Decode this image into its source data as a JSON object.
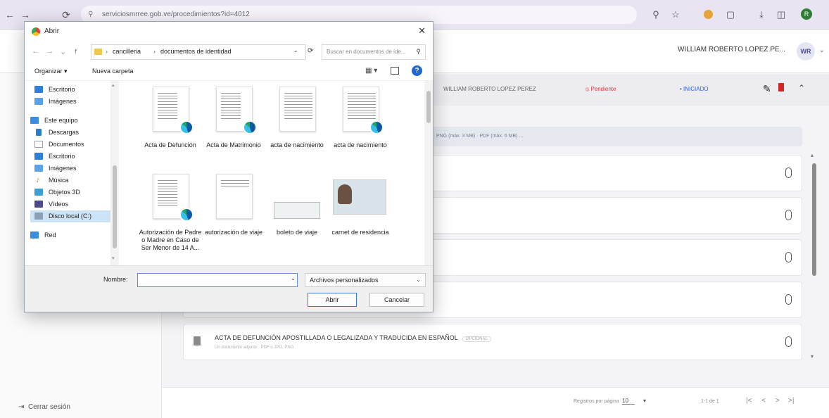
{
  "browser": {
    "url_text": "serviciosmrree.gob.ve/procedimientos?id=4012",
    "nav": [
      "←",
      "→",
      "⟳"
    ],
    "icons": [
      "zoom-icon",
      "star-icon",
      "extension-icon",
      "puzzle-icon",
      "download-icon",
      "sidepanel-icon",
      "profile-icon"
    ],
    "profile_letter": "R",
    "accent": "#2e7d32"
  },
  "app": {
    "user_name": "WILLIAM ROBERTO LOPEZ PE...",
    "avatar_initials": "WR",
    "logout_label": "Cerrar sesión",
    "header": {
      "name": "WILLIAM ROBERTO LOPEZ PEREZ",
      "status_pending": "⦸ Pendiente",
      "status_started": "• INICIADO"
    },
    "info_text": "PNG (máx. 3 MB) · PDF (máx. 6 MB) ...",
    "documents": [
      {
        "title": "",
        "subtitle": ""
      },
      {
        "title": "",
        "subtitle": ""
      },
      {
        "title": "",
        "subtitle": ""
      },
      {
        "title": "",
        "subtitle": ""
      },
      {
        "title": "ACTA DE DEFUNCIÓN APOSTILLADA O LEGALIZADA Y TRADUCIDA EN ESPAÑOL",
        "tag": "OPCIONAL",
        "subtitle": "Un documento adjunto · PDF o JPG, PNG"
      }
    ],
    "pagination": {
      "rows_label": "Registros por página",
      "rows_value": "10",
      "range": "1-1 de 1",
      "controls": [
        "|<",
        "<",
        ">",
        ">|"
      ]
    }
  },
  "dialog": {
    "title": "Abrir",
    "close": "✕",
    "nav_arrows": [
      "←",
      "→",
      "⌄",
      "↑"
    ],
    "breadcrumb": [
      "cancilleria",
      "documentos de identidad"
    ],
    "breadcrumb_sep": "›",
    "search_placeholder": "Buscar en documentos de ide...",
    "organize_label": "Organizar ▾",
    "new_folder_label": "Nueva carpeta",
    "help": "?",
    "nav_items": [
      {
        "label": "Escritorio",
        "color": "#2f7fd6"
      },
      {
        "label": "Imágenes",
        "color": "#5aa3e6"
      },
      {
        "label": "Este equipo",
        "color": "#3a8de0"
      },
      {
        "label": "Descargas",
        "color": "#2b7bd0"
      },
      {
        "label": "Documentos",
        "color": "#9aa0a8"
      },
      {
        "label": "Escritorio",
        "color": "#2f7fd6"
      },
      {
        "label": "Imágenes",
        "color": "#5aa3e6"
      },
      {
        "label": "Música",
        "color": "#e06a32"
      },
      {
        "label": "Objetos 3D",
        "color": "#3a9fd6"
      },
      {
        "label": "Vídeos",
        "color": "#4a4a8a"
      },
      {
        "label": "Disco local (C:)",
        "color": "#8aa0b8"
      },
      {
        "label": "Red",
        "color": "#3a8de0"
      }
    ],
    "files": [
      {
        "name": "Acta de Defunción",
        "kind": "pdf-edge"
      },
      {
        "name": "Acta de Matrimonio",
        "kind": "pdf-edge"
      },
      {
        "name": "acta de nacimiento",
        "kind": "scan"
      },
      {
        "name": "acta de nacimiento",
        "kind": "scan-edge"
      },
      {
        "name": "Autorización de Padre o Madre en Caso de Ser Menor de 14 A...",
        "kind": "pdf-edge"
      },
      {
        "name": "autorización de viaje",
        "kind": "form"
      },
      {
        "name": "boleto de viaje",
        "kind": "ticket"
      },
      {
        "name": "carnet de residencia",
        "kind": "id-card"
      }
    ],
    "filename_label": "Nombre:",
    "filename_value": "",
    "filetype_label": "Archivos personalizados",
    "open_button": "Abrir",
    "cancel_button": "Cancelar"
  }
}
